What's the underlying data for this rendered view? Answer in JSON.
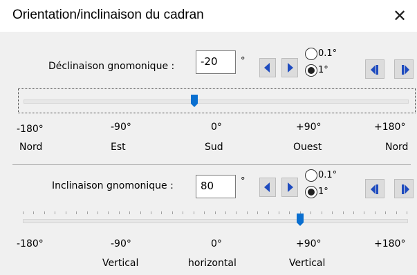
{
  "dialog": {
    "title": "Orientation/inclinaison du cadran",
    "close_glyph": "✕"
  },
  "declinaison": {
    "label": "Déclinaison gnomonique :",
    "value": "-20",
    "unit": "°",
    "step_options": [
      "0.1°",
      "1°"
    ],
    "selected_step": "1°",
    "slider_value_deg": -20,
    "slider_range_deg": [
      -180,
      180
    ],
    "scale_degrees": [
      "-180°",
      "-90°",
      "0°",
      "+90°",
      "+180°"
    ],
    "scale_directions": [
      "Nord",
      "Est",
      "Sud",
      "Ouest",
      "Nord"
    ]
  },
  "inclinaison": {
    "label": "Inclinaison gnomonique :",
    "value": "80",
    "unit": "°",
    "step_options": [
      "0.1°",
      "1°"
    ],
    "selected_step": "1°",
    "slider_value_deg": 80,
    "slider_range_deg": [
      -180,
      180
    ],
    "scale_degrees": [
      "-180°",
      "-90°",
      "0°",
      "+90°",
      "+180°"
    ],
    "scale_positions": [
      "Vertical",
      "horizontal",
      "Vertical"
    ]
  },
  "icons": {
    "arrow_left": "arrow-left-icon",
    "arrow_right": "arrow-right-icon",
    "skip_left": "skip-left-icon",
    "skip_right": "skip-right-icon",
    "close": "close-icon"
  },
  "colors": {
    "accent": "#1e4bbf",
    "thumb": "#0a6fd0"
  }
}
